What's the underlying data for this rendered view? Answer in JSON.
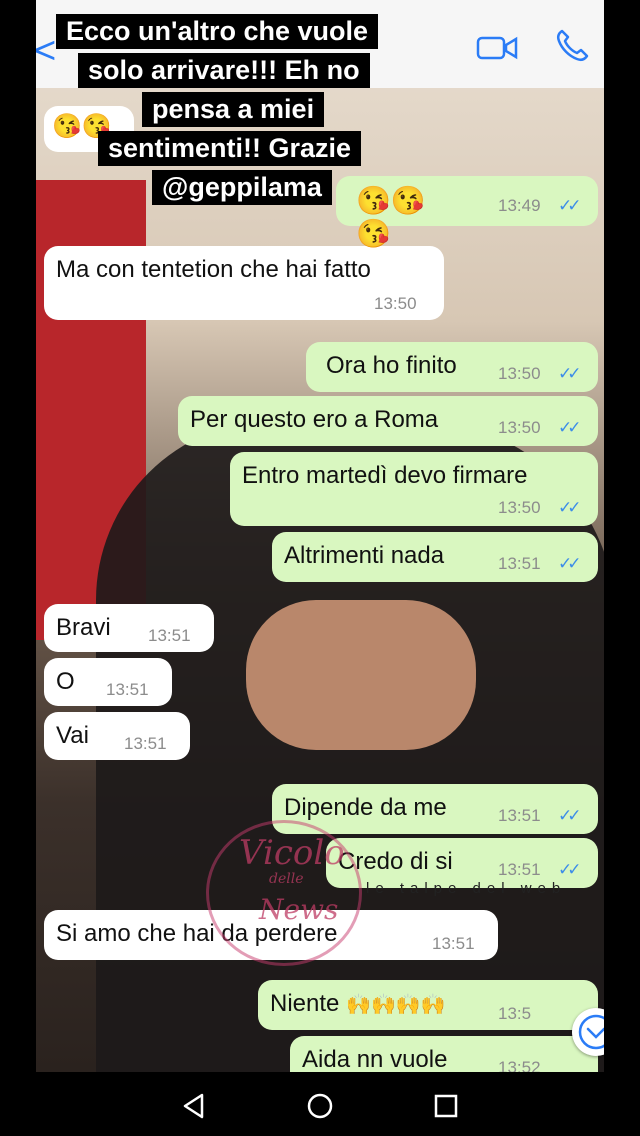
{
  "story_caption": {
    "lines": [
      "Ecco un'altro che vuole",
      "solo arrivare!!! Eh no",
      "pensa a miei",
      "sentimenti!! Grazie",
      "@geppilama"
    ],
    "emoji": "😘😘😘"
  },
  "header": {
    "back_glyph": "<"
  },
  "chat": {
    "partial_top_emoji": "😘😘",
    "messages": [
      {
        "dir": "out",
        "text": "",
        "time": "13:49"
      },
      {
        "dir": "in",
        "text": "Ma con tentetion che hai fatto",
        "time": "13:50"
      },
      {
        "dir": "out",
        "text": "Ora ho finito",
        "time": "13:50"
      },
      {
        "dir": "out",
        "text": "Per questo ero a Roma",
        "time": "13:50"
      },
      {
        "dir": "out",
        "text": "Entro martedì devo firmare",
        "time": "13:50"
      },
      {
        "dir": "out",
        "text": "Altrimenti nada",
        "time": "13:51"
      },
      {
        "dir": "in",
        "text": "Bravi",
        "time": "13:51"
      },
      {
        "dir": "in",
        "text": "O",
        "time": "13:51"
      },
      {
        "dir": "in",
        "text": "Vai",
        "time": "13:51"
      },
      {
        "dir": "out",
        "text": "Dipende da me",
        "time": "13:51"
      },
      {
        "dir": "out",
        "text": "Credo di si",
        "time": "13:51"
      },
      {
        "dir": "in",
        "text": "Si amo che hai da perdere",
        "time": "13:51"
      },
      {
        "dir": "out",
        "text": "Niente",
        "time": "13:5",
        "emoji": "🙌🙌🙌🙌"
      },
      {
        "dir": "out",
        "text": "Aida nn vuole",
        "time": "13:52"
      }
    ]
  },
  "watermark": {
    "line1": "Vicolo",
    "line2": "delle",
    "line3": "News",
    "band": "le talpe del web"
  },
  "colors": {
    "outgoing_bubble": "#d9f7c0",
    "incoming_bubble": "#ffffff",
    "read_ticks": "#3d8de8",
    "ios_blue": "#2b7cf6"
  },
  "icons": [
    "back-arrow-icon",
    "video-call-icon",
    "phone-icon",
    "double-check-icon",
    "scroll-down-icon",
    "nav-back-icon",
    "nav-home-icon",
    "nav-recents-icon"
  ]
}
